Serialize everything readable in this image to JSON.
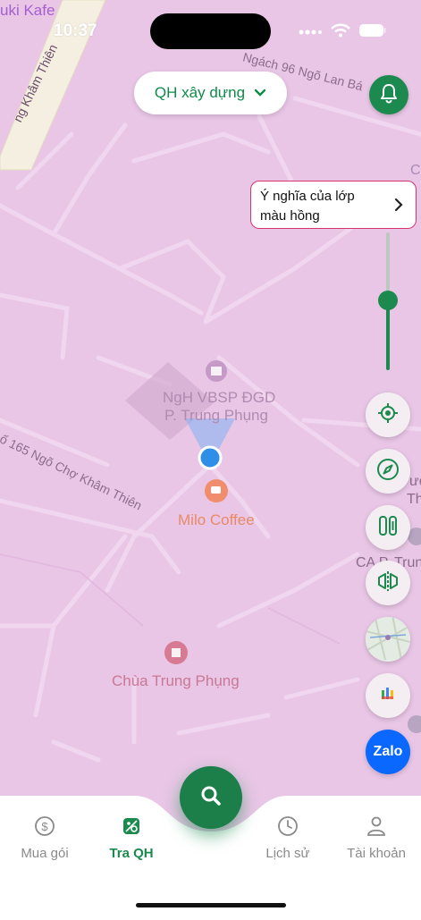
{
  "status_bar": {
    "time": "10:37"
  },
  "map": {
    "labels": {
      "kafe": "uki Kafe",
      "kham_thien": "ng Khâm Thiên",
      "ngach96": "Ngách 96 Ngõ Lan Bá",
      "ngo165": "ố 165 Ngõ Chợ Khâm Thiên",
      "ngh_line1": "NgH VBSP ĐGD",
      "ngh_line2": "P. Trung Phụng",
      "milo": "Milo Coffee",
      "chua": "Chùa Trung Phụng",
      "right_c": "C",
      "right_uon": "ườ",
      "right_thuc": "Thực",
      "right_ca": "CA P. Trun"
    }
  },
  "layer_select": {
    "label": "QH xây dựng"
  },
  "legend_card": {
    "text_line1": "Ý nghĩa của lớp",
    "text_line2": "màu hồng"
  },
  "opacity_slider": {
    "value_fraction": 0.5
  },
  "right_buttons": {
    "zalo_label": "Zalo"
  },
  "bottom_nav": {
    "tabs": [
      {
        "label": "Mua gói",
        "icon": "dollar-icon"
      },
      {
        "label": "Tra QH",
        "icon": "map-search-icon",
        "active": true
      },
      {
        "label": "Lịch sử",
        "icon": "clock-icon"
      },
      {
        "label": "Tài khoản",
        "icon": "user-icon"
      }
    ]
  },
  "colors": {
    "accent": "#1c8a4e",
    "map_bg": "#e9c6e6",
    "legend_border": "#d8336d",
    "zalo": "#0b68ff"
  }
}
